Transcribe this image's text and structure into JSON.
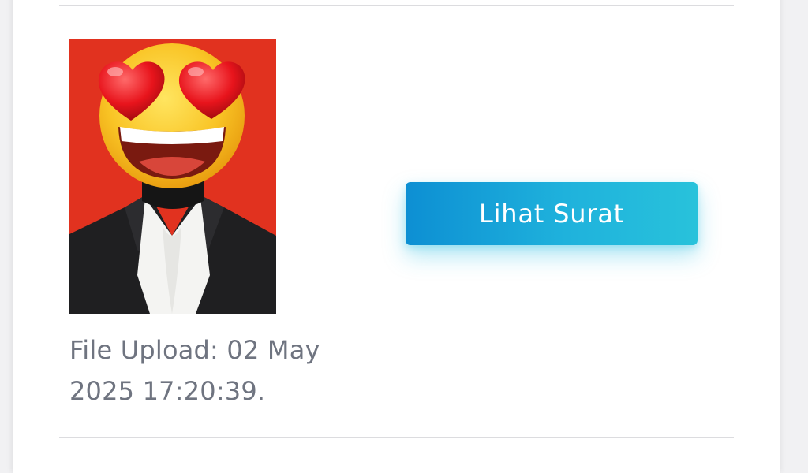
{
  "upload": {
    "text": "File Upload: 02 May 2025 17:20:39."
  },
  "actions": {
    "view_letter_label": "Lihat Surat"
  },
  "photo": {
    "icon": "heart-eyes-emoji-icon",
    "background_color": "#e1321f"
  },
  "colors": {
    "button_gradient_start": "#0d8fd3",
    "button_gradient_end": "#28c2db",
    "text_muted": "#6f7480"
  }
}
